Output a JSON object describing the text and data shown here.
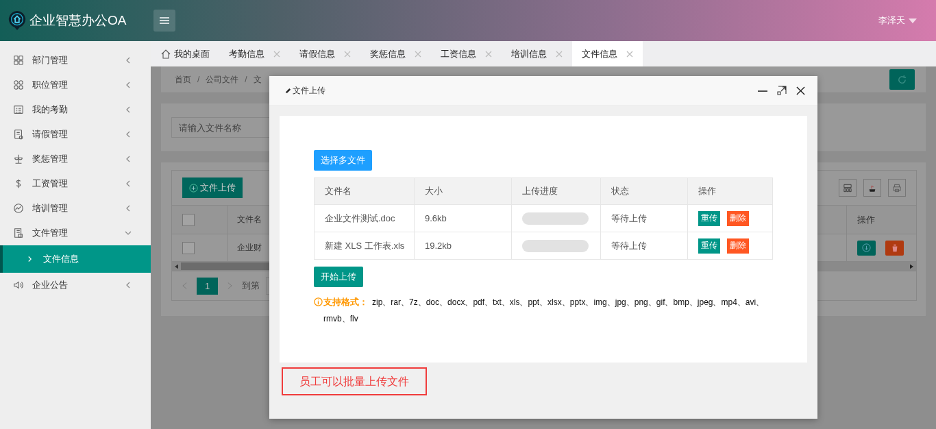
{
  "header": {
    "title": "企业智慧办公OA",
    "user": "李泽天"
  },
  "sidebar": {
    "items": [
      {
        "label": "部门管理",
        "expanded": false,
        "selected": false
      },
      {
        "label": "职位管理",
        "expanded": false,
        "selected": false
      },
      {
        "label": "我的考勤",
        "expanded": false,
        "selected": false
      },
      {
        "label": "请假管理",
        "expanded": false,
        "selected": false
      },
      {
        "label": "奖惩管理",
        "expanded": false,
        "selected": false
      },
      {
        "label": "工资管理",
        "expanded": false,
        "selected": false
      },
      {
        "label": "培训管理",
        "expanded": false,
        "selected": false
      },
      {
        "label": "文件管理",
        "expanded": true,
        "selected": false,
        "children": [
          {
            "label": "文件信息",
            "selected": true
          }
        ]
      },
      {
        "label": "企业公告",
        "expanded": false,
        "selected": false
      }
    ]
  },
  "tabs": [
    {
      "label": "我的桌面",
      "selected": false,
      "closable": false
    },
    {
      "label": "考勤信息",
      "selected": false,
      "closable": true
    },
    {
      "label": "请假信息",
      "selected": false,
      "closable": true
    },
    {
      "label": "奖惩信息",
      "selected": false,
      "closable": true
    },
    {
      "label": "工资信息",
      "selected": false,
      "closable": true
    },
    {
      "label": "培训信息",
      "selected": false,
      "closable": true
    },
    {
      "label": "文件信息",
      "selected": true,
      "closable": true
    }
  ],
  "breadcrumb": {
    "items": [
      "首页",
      "公司文件",
      "文"
    ],
    "separator": "/"
  },
  "search": {
    "placeholder": "请输入文件名称"
  },
  "file_table": {
    "add_button": "文件上传",
    "header_checked": false,
    "columns": [
      "文件名",
      "操作"
    ],
    "rows": [
      {
        "checked": false,
        "name": "企业财"
      }
    ]
  },
  "pagination": {
    "page": "1",
    "goto_label": "到第"
  },
  "dialog": {
    "title": "文件上传",
    "pick_button": "选择多文件",
    "columns": [
      "文件名",
      "大小",
      "上传进度",
      "状态",
      "操作"
    ],
    "rows": [
      {
        "name": "企业文件测试.doc",
        "size": "9.6kb",
        "level": 0,
        "status": "等待上传",
        "retry": "重传",
        "delete": "删除"
      },
      {
        "name": "新建 XLS 工作表.xls",
        "size": "19.2kb",
        "level": 0,
        "status": "等待上传",
        "retry": "重传",
        "delete": "删除"
      }
    ],
    "start_button": "开始上传",
    "formats_label": "支持格式：",
    "formats": "zip、rar、7z、doc、docx、pdf、txt、xls、ppt、xlsx、pptx、img、jpg、png、gif、bmp、jpeg、mp4、avi、rmvb、flv"
  },
  "note": "员工可以批量上传文件"
}
